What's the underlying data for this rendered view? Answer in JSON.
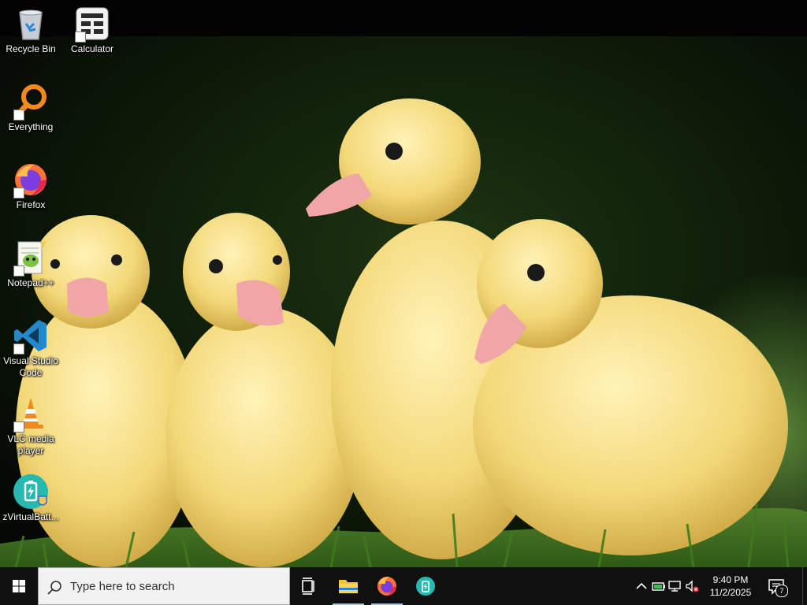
{
  "desktop": {
    "wallpaper": "ducklings-on-grass",
    "icons": [
      {
        "name": "recycle-bin",
        "label": "Recycle Bin",
        "icon": "recycle-bin-icon"
      },
      {
        "name": "calculator",
        "label": "Calculator",
        "icon": "calculator-icon"
      },
      {
        "name": "everything",
        "label": "Everything",
        "icon": "magnifier-icon"
      },
      {
        "name": "firefox",
        "label": "Firefox",
        "icon": "firefox-icon"
      },
      {
        "name": "notepad-plus-plus",
        "label": "Notepad++",
        "icon": "notepad-plus-plus-icon"
      },
      {
        "name": "visual-studio-code",
        "label": "Visual Studio Code",
        "icon": "vscode-icon"
      },
      {
        "name": "vlc",
        "label": "VLC media player",
        "icon": "vlc-cone-icon"
      },
      {
        "name": "zvirtualbattery",
        "label": "zVirtualBatt...",
        "icon": "battery-shield-icon"
      }
    ]
  },
  "taskbar": {
    "search_placeholder": "Type here to search",
    "pinned": [
      {
        "name": "task-view",
        "icon": "task-view-icon"
      },
      {
        "name": "file-explorer",
        "icon": "folder-icon"
      },
      {
        "name": "firefox",
        "icon": "firefox-icon"
      },
      {
        "name": "zvirtualbattery",
        "icon": "battery-shield-icon"
      }
    ],
    "tray": {
      "time": "9:40 PM",
      "date": "11/2/2025",
      "notification_count": "7"
    }
  },
  "colors": {
    "taskbar_bg": "#101010",
    "search_bg": "#f2f2f2",
    "start_blue": "#ffffff",
    "active_indicator": "#9cc7ee"
  }
}
